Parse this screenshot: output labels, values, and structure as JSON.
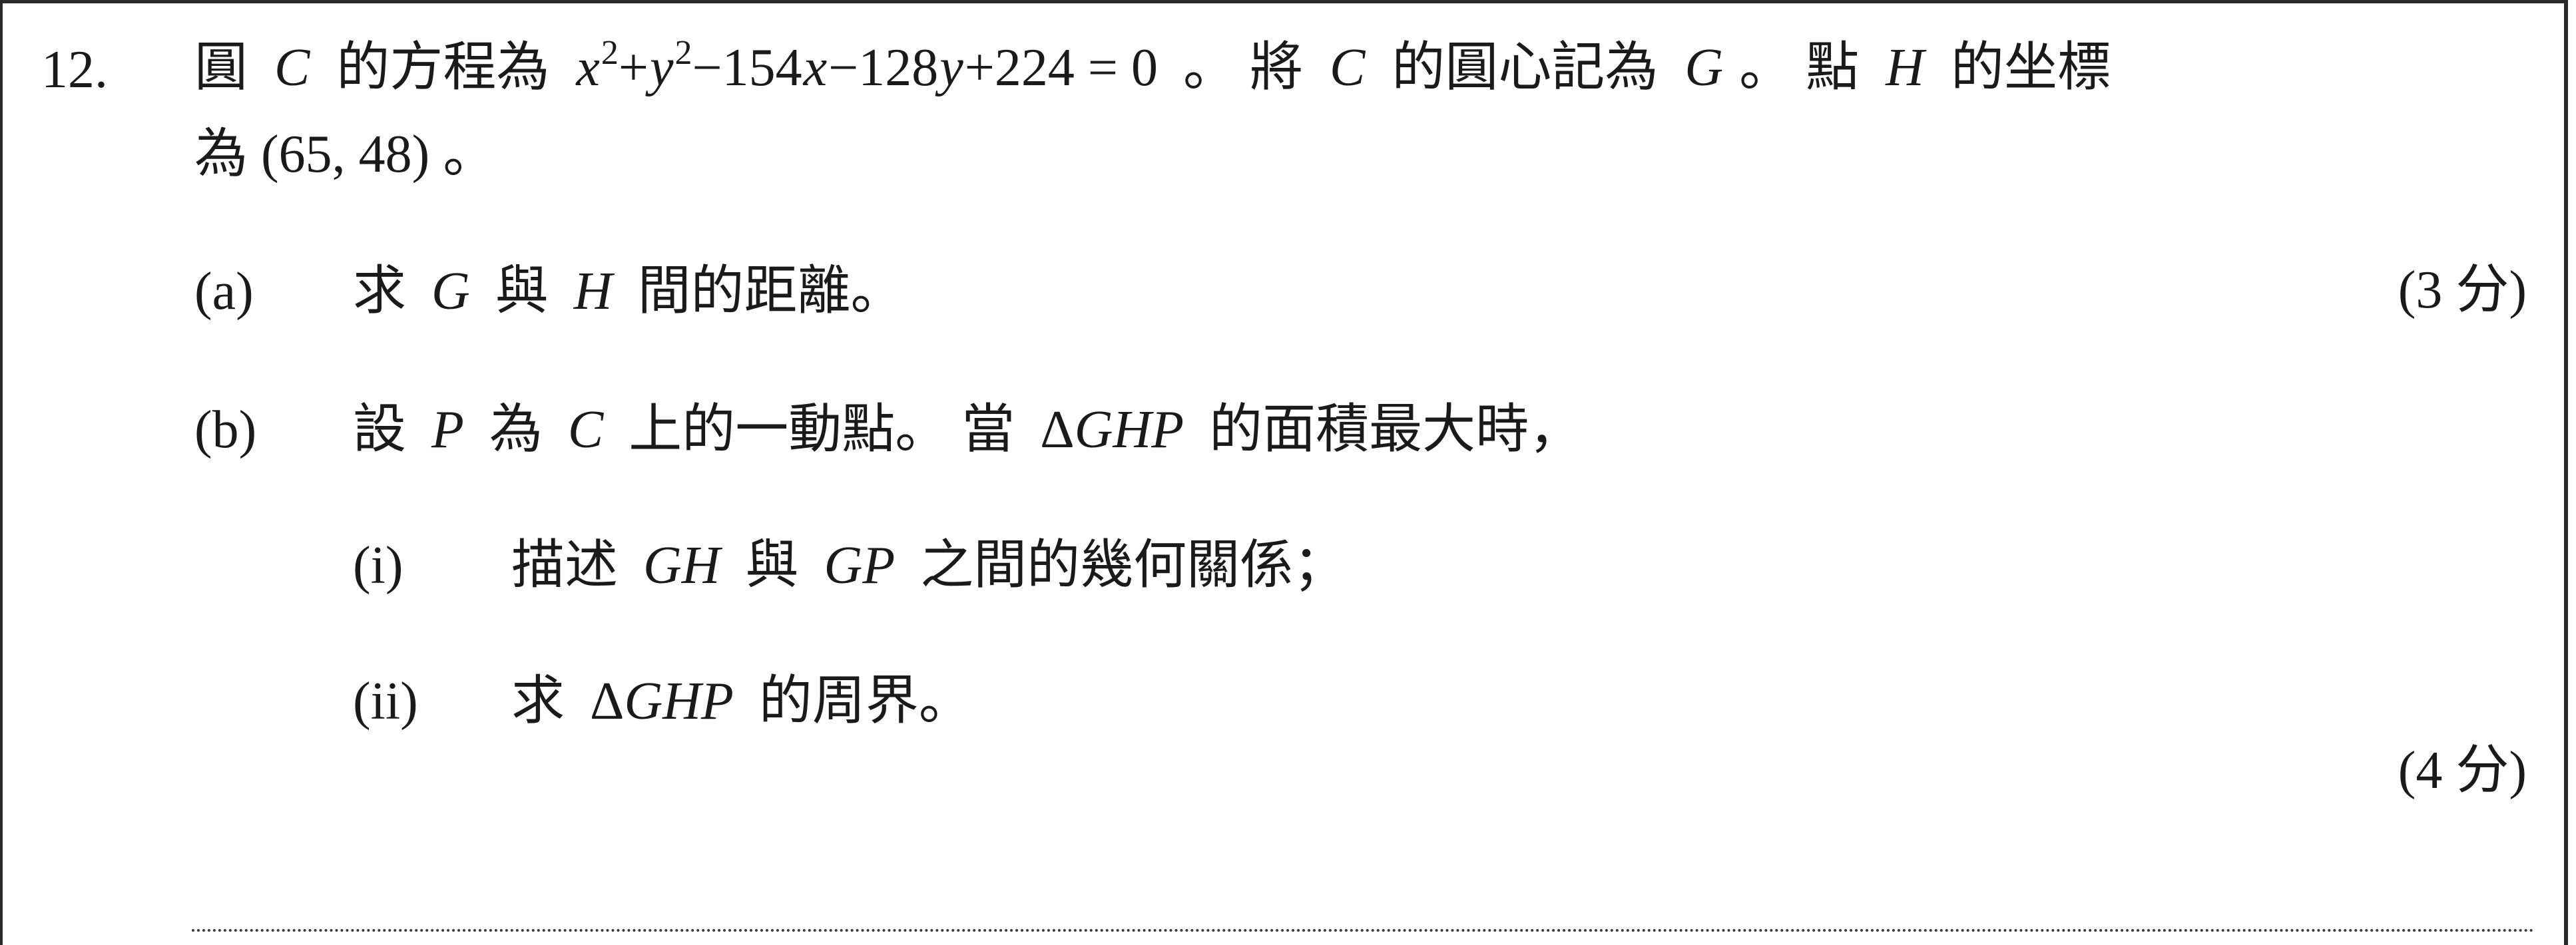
{
  "question": {
    "number": "12.",
    "stem": {
      "p1": "圓",
      "c1": "C",
      "p2": "的方程為",
      "eq_x": "x",
      "eq_sq1": "2",
      "eq_plus1": "+",
      "eq_y": "y",
      "eq_sq2": "2",
      "eq_m1": "−154",
      "eq_x2": "x",
      "eq_m2": "−128",
      "eq_y2": "y",
      "eq_tail": "+224 = 0",
      "p3": "。 將",
      "c2": "C",
      "p4": "的圓心記為",
      "g1": "G",
      "p5": "。 點",
      "h1": "H",
      "p6": "的坐標",
      "line2": "為 (65, 48) 。"
    },
    "part_a": {
      "label": "(a)",
      "t1": "求",
      "g": "G",
      "t2": "與",
      "h": "H",
      "t3": "間的距離。",
      "marks": "(3 分)"
    },
    "part_b": {
      "label": "(b)",
      "t1": "設",
      "p": "P",
      "t2": "為",
      "c": "C",
      "t3": "上的一動點。 當",
      "delta": "Δ",
      "ghp": "GHP",
      "t4": "的面積最大時，",
      "sub_i": {
        "label": "(i)",
        "t1": "描述",
        "gh": "GH",
        "t2": "與",
        "gp": "GP",
        "t3": "之間的幾何關係；"
      },
      "sub_ii": {
        "label": "(ii)",
        "t1": "求",
        "delta": "Δ",
        "ghp": "GHP",
        "t2": "的周界。"
      },
      "marks": "(4 分)"
    }
  }
}
